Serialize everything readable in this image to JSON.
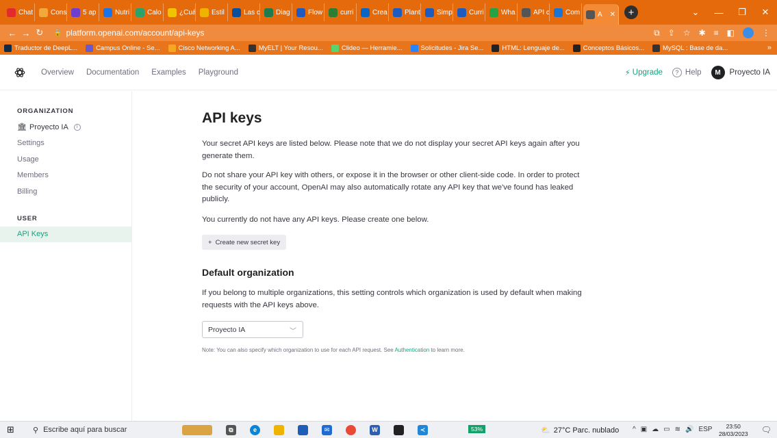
{
  "browser": {
    "tabs": [
      {
        "label": "Chat",
        "color": "#e22b2b",
        "icon": "youtube-icon"
      },
      {
        "label": "Cons",
        "color": "#f2a93b",
        "icon": "orange-circle-icon"
      },
      {
        "label": "5 ap",
        "color": "#6e3fcf",
        "icon": "v-logo-icon"
      },
      {
        "label": "Nutri",
        "color": "#1a73e8",
        "icon": "fd-icon"
      },
      {
        "label": "Calo",
        "color": "#2aa36b",
        "icon": "calorie-icon"
      },
      {
        "label": "¿Cuá",
        "color": "#f2c300",
        "icon": "question-icon"
      },
      {
        "label": "Estil",
        "color": "#f2b300",
        "icon": "style-icon"
      },
      {
        "label": "Las c",
        "color": "#0a4f9e",
        "icon": "c-logo-icon"
      },
      {
        "label": "Diag",
        "color": "#1f7a4d",
        "icon": "chart-icon"
      },
      {
        "label": "Flow",
        "color": "#1d5bbf",
        "icon": "flow-icon"
      },
      {
        "label": "curri",
        "color": "#2e7d32",
        "icon": "g-icon"
      },
      {
        "label": "Crea",
        "color": "#0a66c2",
        "icon": "create-icon"
      },
      {
        "label": "Plant",
        "color": "#1d5bbf",
        "icon": "c-circle-icon"
      },
      {
        "label": "Simp",
        "color": "#1d5bbf",
        "icon": "c-circle-icon"
      },
      {
        "label": "Curri",
        "color": "#1d5bbf",
        "icon": "c-circle-icon"
      },
      {
        "label": "Wha",
        "color": "#25a244",
        "icon": "whatsapp-icon"
      },
      {
        "label": "API c",
        "color": "#555",
        "icon": "openai-icon"
      },
      {
        "label": "Com",
        "color": "#1b74d4",
        "icon": "com-icon"
      },
      {
        "label": "A",
        "color": "#555",
        "icon": "openai-icon",
        "active": true
      }
    ],
    "url": "platform.openai.com/account/api-keys",
    "bookmarks": [
      {
        "label": "Traductor de DeepL...",
        "color": "#0f2b46"
      },
      {
        "label": "Campus Online - Se...",
        "color": "#6a5acd"
      },
      {
        "label": "Cisco Networking A...",
        "color": "#f5a623"
      },
      {
        "label": "MyELT | Your Resou...",
        "color": "#333"
      },
      {
        "label": "Clideo — Herramie...",
        "color": "#5ad26f"
      },
      {
        "label": "Solicitudes - Jira Se...",
        "color": "#2684ff"
      },
      {
        "label": "HTML: Lenguaje de...",
        "color": "#222"
      },
      {
        "label": "Conceptos Básicos...",
        "color": "#222"
      },
      {
        "label": "MySQL : Base de da...",
        "color": "#333"
      }
    ],
    "bookmarks_more": "»"
  },
  "header": {
    "nav": [
      "Overview",
      "Documentation",
      "Examples",
      "Playground"
    ],
    "upgrade": "Upgrade",
    "help": "Help",
    "avatar_initial": "M",
    "account_name": "Proyecto IA"
  },
  "sidebar": {
    "org_heading": "ORGANIZATION",
    "org_name": "Proyecto IA",
    "org_items": [
      "Settings",
      "Usage",
      "Members",
      "Billing"
    ],
    "user_heading": "USER",
    "user_items": [
      "API Keys"
    ]
  },
  "main": {
    "title": "API keys",
    "para1": "Your secret API keys are listed below. Please note that we do not display your secret API keys again after you generate them.",
    "para2": "Do not share your API key with others, or expose it in the browser or other client-side code. In order to protect the security of your account, OpenAI may also automatically rotate any API key that we've found has leaked publicly.",
    "para3": "You currently do not have any API keys. Please create one below.",
    "create_button": "Create new secret key",
    "default_org_heading": "Default organization",
    "default_org_text": "If you belong to multiple organizations, this setting controls which organization is used by default when making requests with the API keys above.",
    "org_select_value": "Proyecto IA",
    "note_prefix": "Note: You can also specify which organization to use for each API request. See ",
    "note_link": "Authentication",
    "note_suffix": " to learn more."
  },
  "taskbar": {
    "search_placeholder": "Escribe aquí para buscar",
    "battery": "53%",
    "weather": "27°C  Parc. nublado",
    "lang": "ESP",
    "time": "23:50",
    "date": "28/03/2023"
  }
}
